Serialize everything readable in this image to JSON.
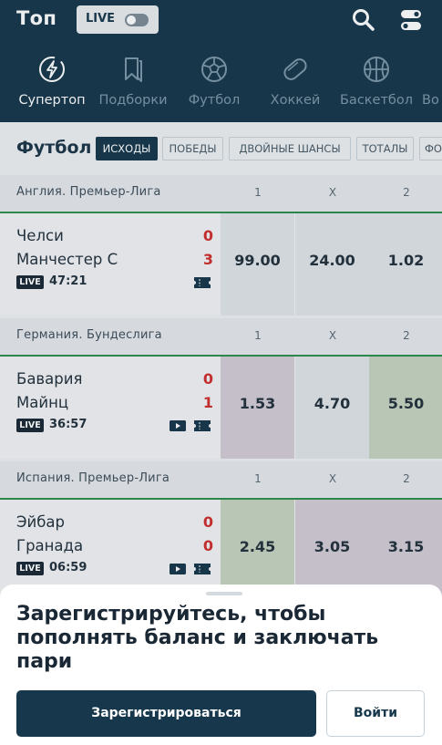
{
  "app": {
    "title": "Топ",
    "live_label": "LIVE"
  },
  "categories": [
    {
      "label": "Супертоп",
      "icon": "bolt-icon",
      "active": true
    },
    {
      "label": "Подборки",
      "icon": "bookmark-icon",
      "active": false
    },
    {
      "label": "Футбол",
      "icon": "soccer-ball-icon",
      "active": false
    },
    {
      "label": "Хоккей",
      "icon": "hockey-puck-icon",
      "active": false
    },
    {
      "label": "Баскетбол",
      "icon": "basketball-icon",
      "active": false
    },
    {
      "label": "Во",
      "icon": "",
      "active": false
    }
  ],
  "section": {
    "title": "Футбол"
  },
  "filters": [
    {
      "label": "ИСХОДЫ",
      "active": true
    },
    {
      "label": "ПОБЕДЫ",
      "active": false
    },
    {
      "label": "ДВОЙНЫЕ ШАНСЫ",
      "active": false
    },
    {
      "label": "ТОТАЛЫ",
      "active": false
    },
    {
      "label": "ФО",
      "active": false
    }
  ],
  "columns": [
    "1",
    "X",
    "2"
  ],
  "leagues": [
    {
      "name": "Англия. Премьер-Лига",
      "match": {
        "team1": "Челси",
        "team2": "Манчестер С",
        "score1": "0",
        "score2": "3",
        "live": "LIVE",
        "time": "47:21",
        "odds": [
          "99.00",
          "24.00",
          "1.02"
        ]
      }
    },
    {
      "name": "Германия. Бундеслига",
      "match": {
        "team1": "Бавария",
        "team2": "Майнц",
        "score1": "0",
        "score2": "1",
        "live": "LIVE",
        "time": "36:57",
        "odds": [
          "1.53",
          "4.70",
          "5.50"
        ]
      }
    },
    {
      "name": "Испания. Премьер-Лига",
      "match": {
        "team1": "Эйбар",
        "team2": "Гранада",
        "score1": "0",
        "score2": "0",
        "live": "LIVE",
        "time": "06:59",
        "odds": [
          "2.45",
          "3.05",
          "3.15"
        ]
      }
    }
  ],
  "sheet": {
    "title": "Зарегистрируйтесь, чтобы пополнять баланс и заключать пари",
    "register_label": "Зарегистрироваться",
    "login_label": "Войти"
  },
  "colors": {
    "header_bg": "#17384c",
    "accent_green": "#2f8f4e",
    "score_red": "#d12e2e",
    "odd_up": "#c8d4c0",
    "odd_down": "#d3ccd6"
  }
}
